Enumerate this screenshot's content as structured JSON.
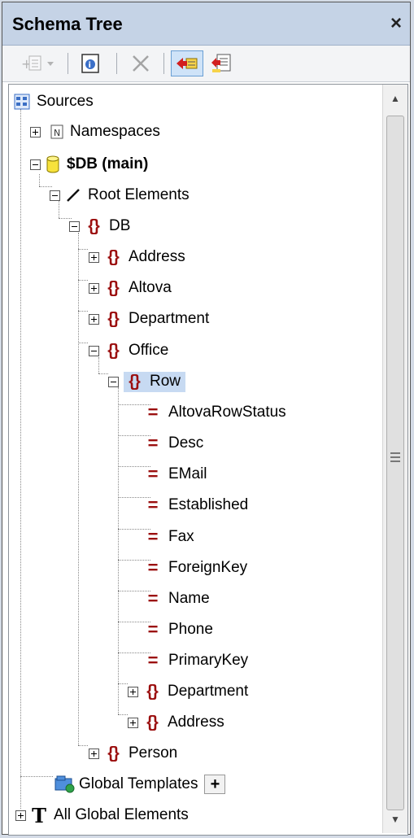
{
  "panel": {
    "title": "Schema Tree",
    "close_label": "×"
  },
  "toolbar": {
    "add_icon": "add-node-icon",
    "properties_icon": "properties-icon",
    "delete_icon": "delete-icon",
    "sync_icon": "sync-tree-icon",
    "sort_icon": "sort-icon"
  },
  "tree": {
    "sources": "Sources",
    "namespaces": "Namespaces",
    "db_main": "$DB (main)",
    "root_elements": "Root Elements",
    "db": "DB",
    "address": "Address",
    "altova": "Altova",
    "department": "Department",
    "office": "Office",
    "row": "Row",
    "attributes": [
      "AltovaRowStatus",
      "Desc",
      "EMail",
      "Established",
      "Fax",
      "ForeignKey",
      "Name",
      "Phone",
      "PrimaryKey"
    ],
    "row_department": "Department",
    "row_address": "Address",
    "person": "Person",
    "global_templates": "Global Templates",
    "global_templates_add": "+",
    "all_global_elements": "All Global Elements"
  },
  "colors": {
    "element": "#9b0f0f",
    "titlebar": "#c5d3e6",
    "selection": "#c7daf2"
  }
}
